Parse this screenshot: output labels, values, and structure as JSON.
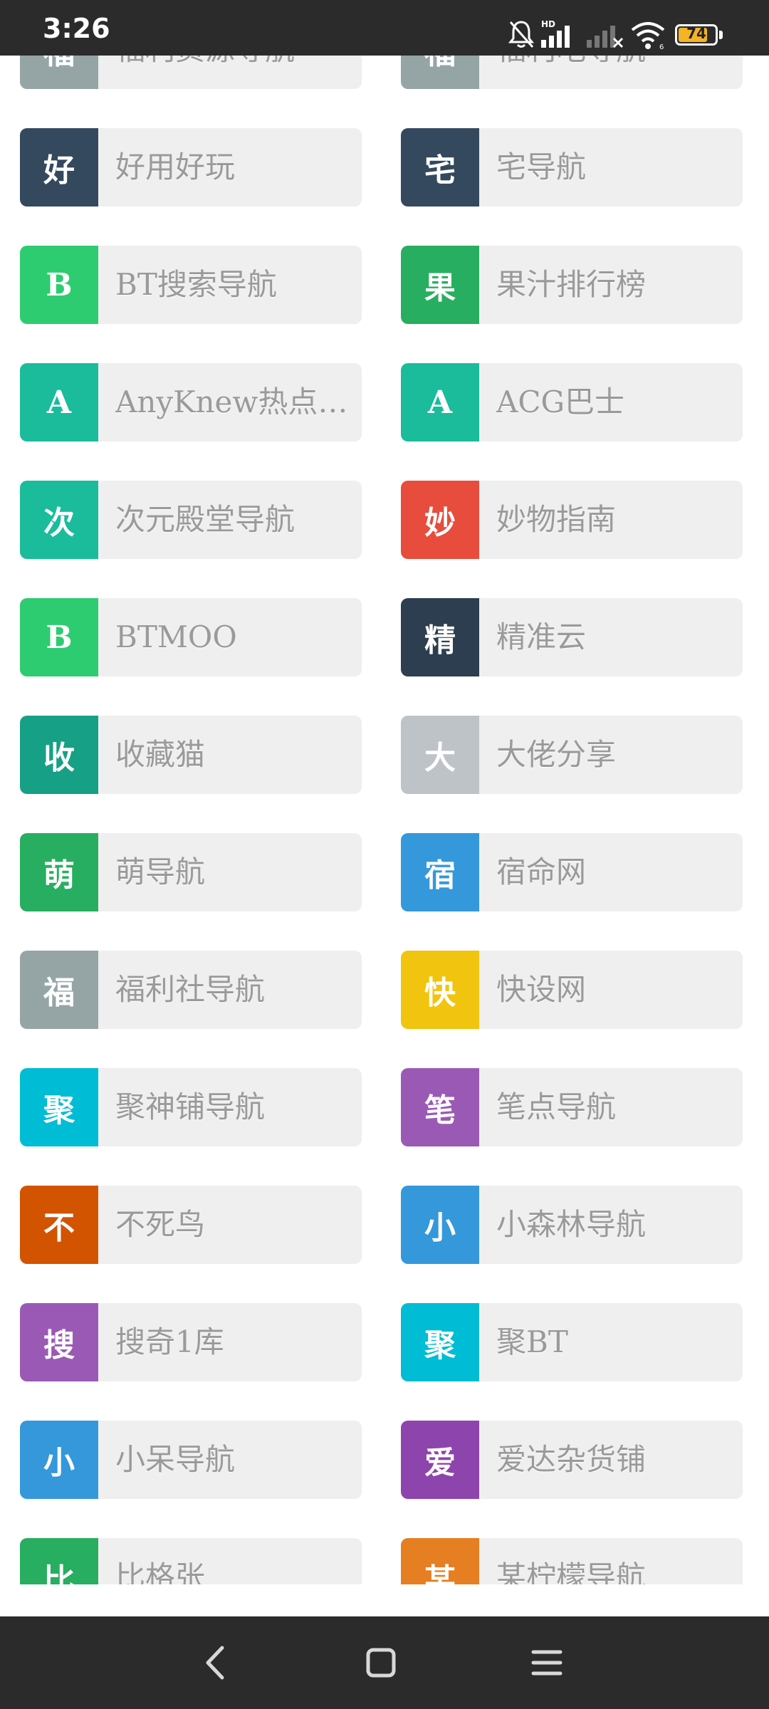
{
  "status_bar": {
    "time": "3:26",
    "battery_level": "74",
    "icons": [
      "mute-bell-icon",
      "hd-signal-icon",
      "signal-off-icon",
      "wifi-icon",
      "battery-icon"
    ]
  },
  "links": [
    {
      "badge": "福",
      "label": "福利资源导航",
      "color": "#95a5a6"
    },
    {
      "badge": "福",
      "label": "福利吧导航",
      "color": "#95a5a6"
    },
    {
      "badge": "好",
      "label": "好用好玩",
      "color": "#34495e"
    },
    {
      "badge": "宅",
      "label": "宅导航",
      "color": "#34495e"
    },
    {
      "badge": "B",
      "label": "BT搜索导航",
      "color": "#2ecc71"
    },
    {
      "badge": "果",
      "label": "果汁排行榜",
      "color": "#27ae60"
    },
    {
      "badge": "A",
      "label": "AnyKnew热点…",
      "color": "#1abc9c"
    },
    {
      "badge": "A",
      "label": "ACG巴士",
      "color": "#1abc9c"
    },
    {
      "badge": "次",
      "label": "次元殿堂导航",
      "color": "#1abc9c"
    },
    {
      "badge": "妙",
      "label": "妙物指南",
      "color": "#e74c3c"
    },
    {
      "badge": "B",
      "label": "BTMOO",
      "color": "#2ecc71"
    },
    {
      "badge": "精",
      "label": "精准云",
      "color": "#2c3e50"
    },
    {
      "badge": "收",
      "label": "收藏猫",
      "color": "#16a085"
    },
    {
      "badge": "大",
      "label": "大佬分享",
      "color": "#bdc3c7"
    },
    {
      "badge": "萌",
      "label": "萌导航",
      "color": "#27ae60"
    },
    {
      "badge": "宿",
      "label": "宿命网",
      "color": "#3498db"
    },
    {
      "badge": "福",
      "label": "福利社导航",
      "color": "#95a5a6"
    },
    {
      "badge": "快",
      "label": "快设网",
      "color": "#f1c40f"
    },
    {
      "badge": "聚",
      "label": "聚神铺导航",
      "color": "#00bcd4"
    },
    {
      "badge": "笔",
      "label": "笔点导航",
      "color": "#9b59b6"
    },
    {
      "badge": "不",
      "label": "不死鸟",
      "color": "#d35400"
    },
    {
      "badge": "小",
      "label": "小森林导航",
      "color": "#3498db"
    },
    {
      "badge": "搜",
      "label": "搜奇1库",
      "color": "#9b59b6"
    },
    {
      "badge": "聚",
      "label": "聚BT",
      "color": "#00bcd4"
    },
    {
      "badge": "小",
      "label": "小呆导航",
      "color": "#3498db"
    },
    {
      "badge": "爱",
      "label": "爱达杂货铺",
      "color": "#8e44ad"
    },
    {
      "badge": "比",
      "label": "比格张",
      "color": "#27ae60"
    },
    {
      "badge": "某",
      "label": "某柠檬导航",
      "color": "#e67e22"
    }
  ],
  "nav_bar": {
    "buttons": [
      "back-icon",
      "home-icon",
      "menu-icon"
    ]
  }
}
